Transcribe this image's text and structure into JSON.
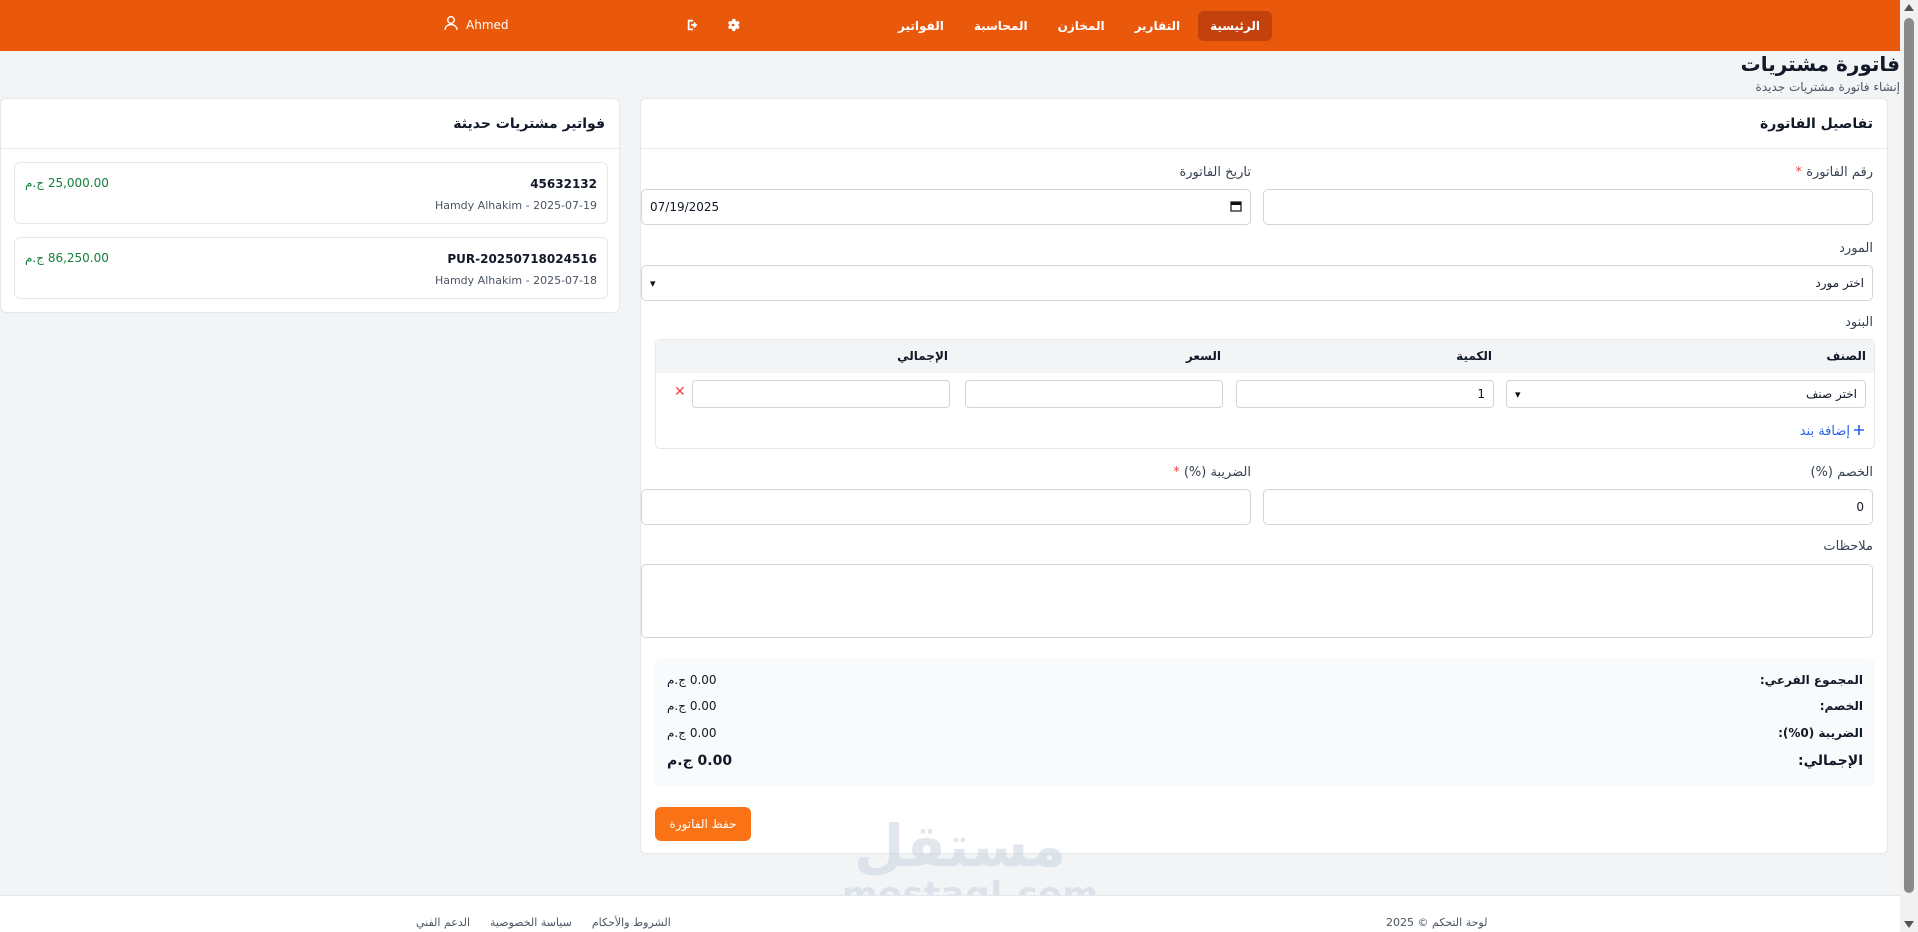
{
  "nav": {
    "items": [
      {
        "label": "الرئيسية",
        "active": true
      },
      {
        "label": "التقارير"
      },
      {
        "label": "المخازن"
      },
      {
        "label": "المحاسبة"
      },
      {
        "label": "الفواتير"
      }
    ],
    "user_name": "Ahmed",
    "icons": {
      "settings": "gear-icon",
      "logout": "sign-out-icon",
      "user": "user-icon"
    }
  },
  "page": {
    "title": "فاتورة مشتريات",
    "subtitle": "إنشاء فاتورة مشتريات جديدة"
  },
  "invoice": {
    "header": "تفاصيل الفاتورة",
    "number_label": "رقم الفاتورة",
    "required_mark": "*",
    "number_value": "",
    "date_label": "تاريخ الفاتورة",
    "date_value": "07/19/2025",
    "supplier_label": "المورد",
    "supplier_value": "اختر مورد",
    "items_label": "البنود",
    "columns": {
      "item": "الصنف",
      "qty": "الكمية",
      "price": "السعر",
      "total": "الإجمالي"
    },
    "line": {
      "item": "اختر صنف",
      "qty": "1",
      "price": "",
      "total": ""
    },
    "remove_glyph": "✕",
    "add_line_label": "إضافة بند",
    "discount_label": "الخصم (%)",
    "discount_value": "0",
    "tax_label": "الضريبة (%)",
    "tax_value": "",
    "notes_label": "ملاحظات",
    "notes_value": "",
    "summary": {
      "subtotal_label": "المجموع الفرعي:",
      "subtotal_value": "0.00 ج.م",
      "discount_label": "الخصم:",
      "discount_value": "0.00 ج.م",
      "tax_label": "الضريبة (0%):",
      "tax_value": "0.00 ج.م",
      "total_label": "الإجمالي:",
      "total_value": "0.00 ج.م"
    },
    "save_label": "حفظ الفاتورة"
  },
  "recent": {
    "header": "فواتير مشتريات حديثة",
    "items": [
      {
        "number": "45632132",
        "meta": "Hamdy Alhakim - 2025-07-19",
        "amount": "25,000.00 ج.م"
      },
      {
        "number": "PUR-20250718024516",
        "meta": "Hamdy Alhakim - 2025-07-18",
        "amount": "86,250.00 ج.م"
      }
    ]
  },
  "watermark": {
    "arabic": "مستقل",
    "latin": "mostaql.com"
  },
  "footer": {
    "copyright": "لوحة التحكم © 2025",
    "links": [
      "الشروط والأحكام",
      "سياسة الخصوصية",
      "الدعم الفني"
    ]
  },
  "colors": {
    "accent": "#ea580c",
    "accent_dark": "#c2410c",
    "button": "#f97316",
    "success": "#15803d",
    "danger": "#ef4444",
    "link": "#2563eb"
  }
}
